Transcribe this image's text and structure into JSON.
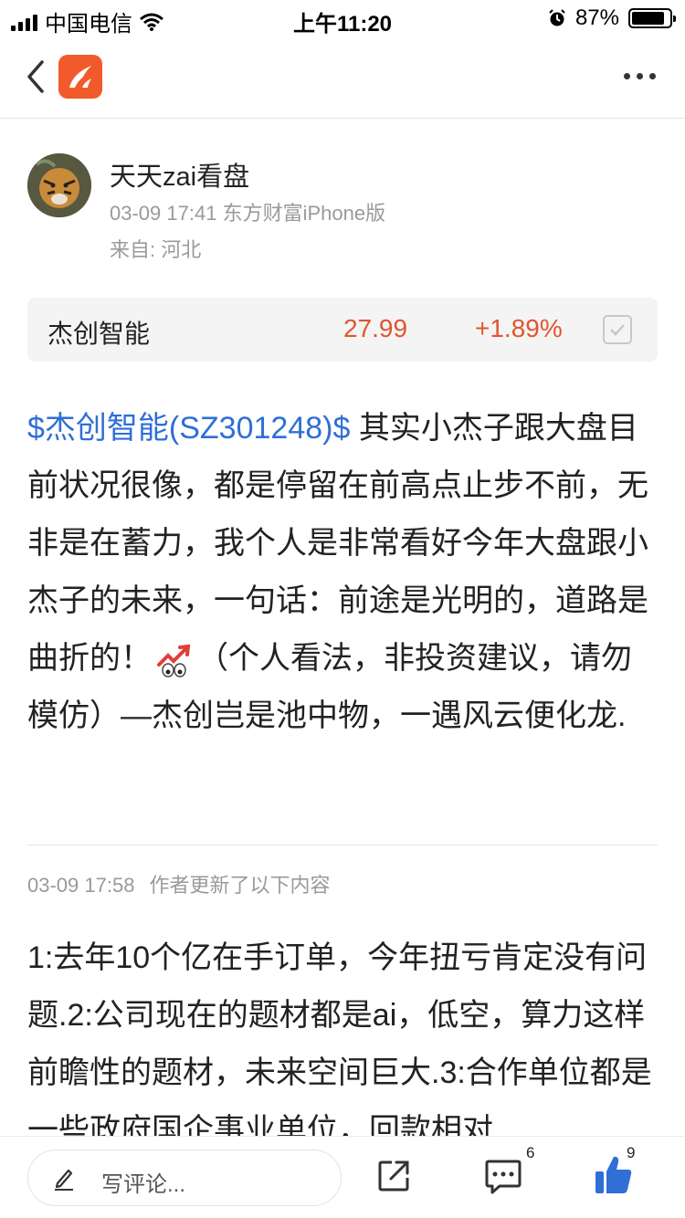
{
  "status_bar": {
    "carrier": "中国电信",
    "time": "上午11:20",
    "battery_pct_text": "87%",
    "battery_level": 0.87
  },
  "nav": {
    "app_logo_icon": "eastmoney-logo-icon",
    "back_icon": "chevron-left-icon",
    "more_icon": "more-dots-icon"
  },
  "author": {
    "name": "天天zai看盘",
    "datetime": "03-09 17:41",
    "source": "东方财富iPhone版",
    "location": "来自: 河北"
  },
  "stock": {
    "name": "杰创智能",
    "price": "27.99",
    "change": "+1.89%",
    "color": "#e1552f"
  },
  "post": {
    "stock_tag": "$杰创智能(SZ301248)$",
    "text_part1": "  其实小杰子跟大盘目前状况很像，都是停留在前高点止步不前，无非是在蓄力，我个人是非常看好今年大盘跟小杰子的未来，一句话：前途是光明的，道路是曲折的！",
    "text_part2": "（个人看法，非投资建议，请勿模仿）—杰创岂是池中物，一遇风云便化龙.",
    "link_color": "#2f6fd6"
  },
  "update": {
    "datetime": "03-09 17:58",
    "label": "作者更新了以下内容",
    "text": "1:去年10个亿在手订单，今年扭亏肯定没有问题.2:公司现在的题材都是ai，低空，算力这样前瞻性的题材，未来空间巨大.3:合作单位都是一些政府国企事业单位，回款相对"
  },
  "bottom_bar": {
    "comment_placeholder": "写评论...",
    "comment_count": "6",
    "like_count": "9",
    "like_color": "#2f6fd6"
  }
}
